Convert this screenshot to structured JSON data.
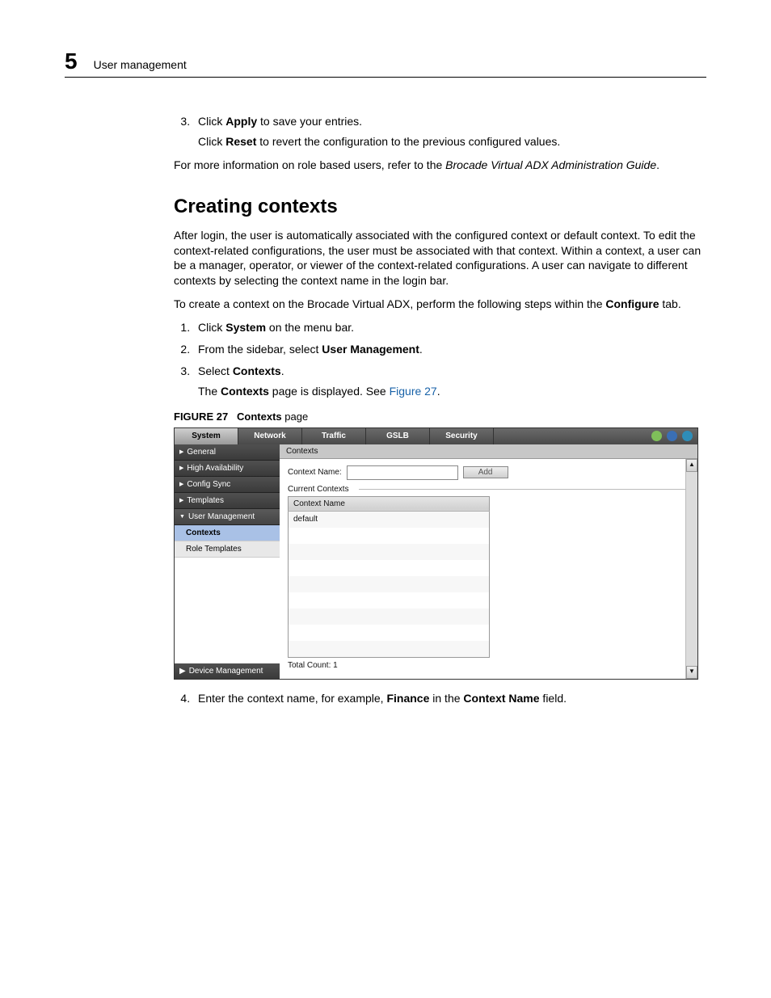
{
  "header": {
    "chapter": "5",
    "title": "User management"
  },
  "intro": {
    "step3_prefix": "Click ",
    "step3_bold": "Apply",
    "step3_suffix": " to save your entries.",
    "step3b_prefix": "Click ",
    "step3b_bold": "Reset",
    "step3b_suffix": " to revert the configuration to the previous configured values.",
    "more_info_prefix": "For more information on role based users, refer to the ",
    "more_info_italic": "Brocade Virtual ADX Administration Guide",
    "more_info_suffix": "."
  },
  "section": {
    "heading": "Creating contexts",
    "p1": "After login, the user is automatically associated with the configured context or default context. To edit the context-related configurations, the user must be associated with that context. Within a context, a user can be a manager, operator, or viewer of the context-related configurations. A user can navigate to different contexts by selecting the context name in the login bar.",
    "p2_prefix": "To create a context on the Brocade Virtual ADX, perform the following steps within the ",
    "p2_bold": "Configure",
    "p2_suffix": " tab.",
    "steps": {
      "s1_a": "Click ",
      "s1_b": "System",
      "s1_c": " on the menu bar.",
      "s2_a": "From the sidebar, select ",
      "s2_b": "User Management",
      "s2_c": ".",
      "s3_a": "Select ",
      "s3_b": "Contexts",
      "s3_c": ".",
      "s3_sub_a": "The ",
      "s3_sub_b": "Contexts",
      "s3_sub_c": " page is displayed. See ",
      "s3_sub_link": "Figure 27",
      "s3_sub_d": "."
    },
    "figure": {
      "label": "FIGURE 27",
      "title_bold": "Contexts",
      "title_rest": " page"
    },
    "step4_a": "Enter the context name, for example, ",
    "step4_b": "Finance",
    "step4_c": " in the ",
    "step4_d": "Context Name",
    "step4_e": " field."
  },
  "shot": {
    "tabs": [
      "System",
      "Network",
      "Traffic",
      "GSLB",
      "Security"
    ],
    "active_tab_index": 0,
    "top_icons": {
      "refresh": "#7fbf5a",
      "save": "#3a6fb5",
      "help": "#2e8db8"
    },
    "sidebar": {
      "items": [
        "General",
        "High Availability",
        "Config Sync",
        "Templates",
        "User Management"
      ],
      "open_index": 4,
      "subitems": [
        "Contexts",
        "Role Templates"
      ],
      "active_sub_index": 0,
      "bottom": "Device Management"
    },
    "main": {
      "breadcrumb": "Contexts",
      "context_name_label": "Context Name:",
      "context_name_value": "",
      "add_label": "Add",
      "fieldset_label": "Current Contexts",
      "table": {
        "header": "Context Name",
        "rows": [
          "default",
          "",
          "",
          "",
          "",
          "",
          "",
          "",
          ""
        ]
      },
      "total_count": "Total Count: 1"
    }
  }
}
